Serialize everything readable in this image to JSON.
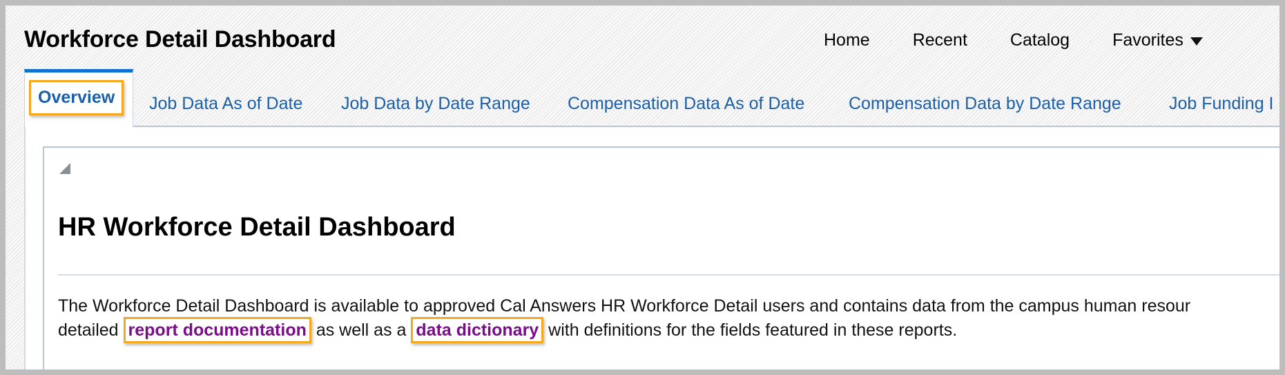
{
  "header": {
    "app_title": "Workforce Detail Dashboard",
    "nav": [
      {
        "label": "Home"
      },
      {
        "label": "Recent"
      },
      {
        "label": "Catalog"
      },
      {
        "label": "Favorites",
        "icon": "caret-down-icon"
      }
    ]
  },
  "tabs": [
    {
      "label": "Overview",
      "active": true
    },
    {
      "label": "Job Data As of Date"
    },
    {
      "label": "Job Data by Date Range"
    },
    {
      "label": "Compensation Data As of Date"
    },
    {
      "label": "Compensation Data by Date Range"
    },
    {
      "label": "Job Funding I"
    }
  ],
  "content": {
    "collapse_icon": "collapse-triangle-icon",
    "heading": "HR Workforce Detail Dashboard",
    "paragraph": {
      "line1": "The Workforce Detail Dashboard is available to approved Cal Answers HR Workforce Detail users and contains data from the campus human resour",
      "line2_prefix": "detailed ",
      "link1": "report documentation",
      "line2_middle": " as well as a ",
      "link2": "data dictionary",
      "line2_suffix": " with definitions for the fields featured in these reports."
    }
  },
  "colors": {
    "tab_text": "#1a5fa8",
    "active_tab_border_top": "#0f72d0",
    "highlight_box": "#f4a81a",
    "link_visited": "#7a0e88"
  }
}
